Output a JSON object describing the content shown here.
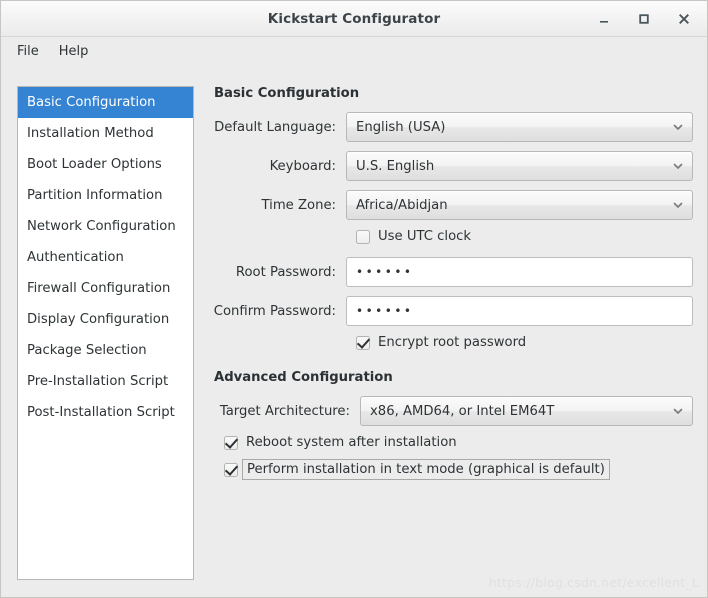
{
  "window": {
    "title": "Kickstart Configurator",
    "controls": {
      "minimize": "minimize",
      "maximize": "maximize",
      "close": "close"
    }
  },
  "menubar": {
    "items": [
      {
        "label": "File"
      },
      {
        "label": "Help"
      }
    ]
  },
  "sidebar": {
    "items": [
      {
        "label": "Basic Configuration",
        "selected": true
      },
      {
        "label": "Installation Method",
        "selected": false
      },
      {
        "label": "Boot Loader Options",
        "selected": false
      },
      {
        "label": "Partition Information",
        "selected": false
      },
      {
        "label": "Network Configuration",
        "selected": false
      },
      {
        "label": "Authentication",
        "selected": false
      },
      {
        "label": "Firewall Configuration",
        "selected": false
      },
      {
        "label": "Display Configuration",
        "selected": false
      },
      {
        "label": "Package Selection",
        "selected": false
      },
      {
        "label": "Pre-Installation Script",
        "selected": false
      },
      {
        "label": "Post-Installation Script",
        "selected": false
      }
    ]
  },
  "basic": {
    "heading": "Basic Configuration",
    "language": {
      "label": "Default Language:",
      "value": "English (USA)"
    },
    "keyboard": {
      "label": "Keyboard:",
      "value": "U.S. English"
    },
    "timezone": {
      "label": "Time Zone:",
      "value": "Africa/Abidjan"
    },
    "utc": {
      "label": "Use UTC clock",
      "checked": false
    },
    "root_password": {
      "label": "Root Password:",
      "value": "••••••"
    },
    "confirm_password": {
      "label": "Confirm Password:",
      "value": "••••••"
    },
    "encrypt": {
      "label": "Encrypt root password",
      "checked": true
    }
  },
  "advanced": {
    "heading": "Advanced Configuration",
    "architecture": {
      "label": "Target Architecture:",
      "value": "x86, AMD64, or Intel EM64T"
    },
    "reboot": {
      "label": "Reboot system after installation",
      "checked": true
    },
    "textmode": {
      "label": "Perform installation in text mode (graphical is default)",
      "checked": true,
      "focused": true
    }
  },
  "watermark": {
    "text": "https://blog.csdn.net/excellent_L"
  },
  "colors": {
    "accent": "#3584d4",
    "background": "#ececec",
    "panel": "#ffffff",
    "text": "#2e3436"
  }
}
